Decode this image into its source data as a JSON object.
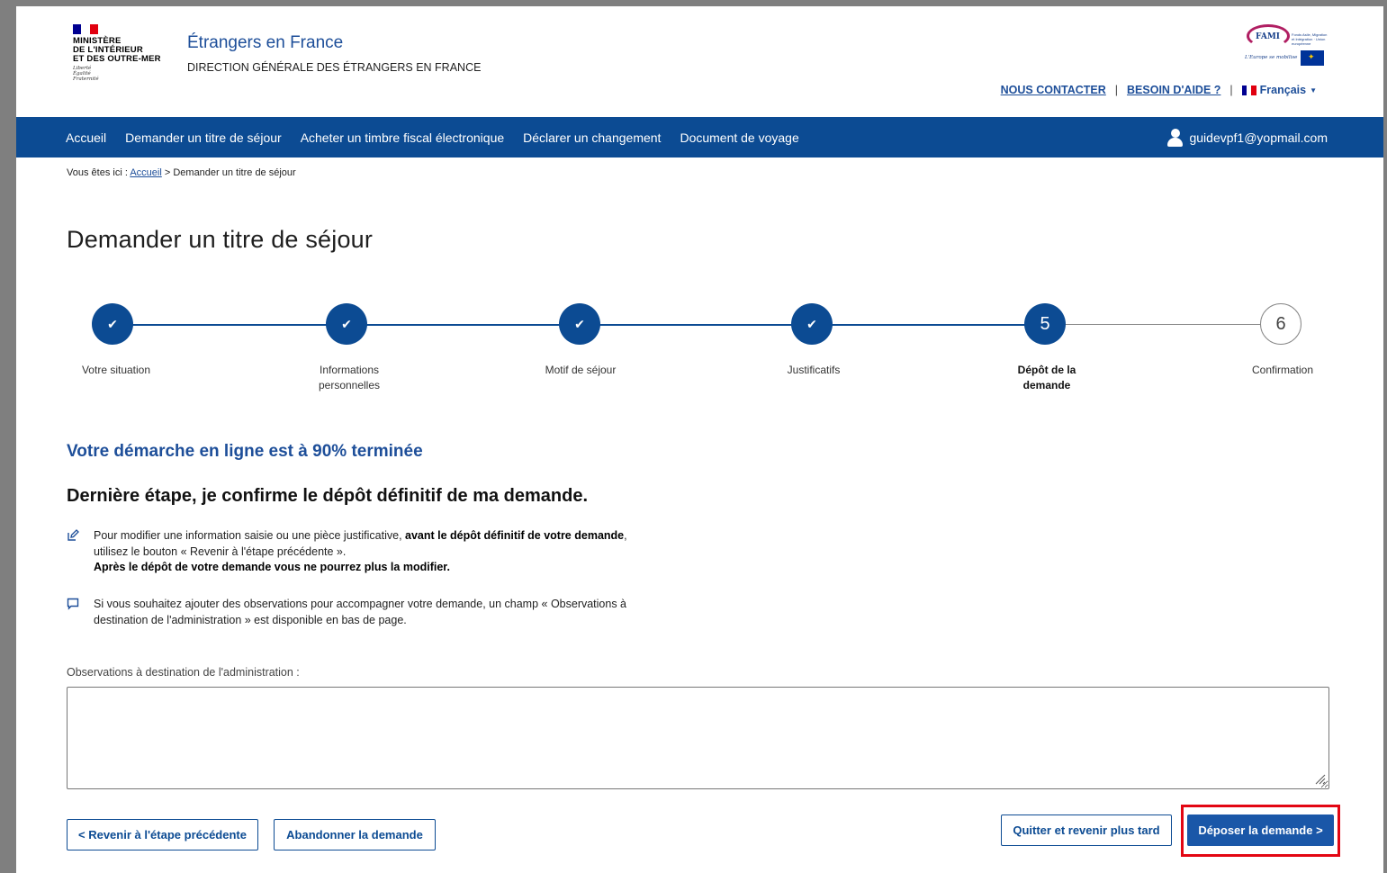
{
  "header": {
    "ministry_lines": [
      "MINISTÈRE",
      "DE L'INTÉRIEUR",
      "ET DES OUTRE-MER"
    ],
    "devise_lines": [
      "Liberté",
      "Égalité",
      "Fraternité"
    ],
    "site_title": "Étrangers en France",
    "site_subtitle": "DIRECTION GÉNÉRALE DES ÉTRANGERS EN FRANCE",
    "fami": {
      "word": "FAMI",
      "small_text": "Fonds Asile, Migration et Intégration · Union européenne",
      "motto": "L'Europe se mobilise"
    },
    "links": {
      "contact": "NOUS CONTACTER",
      "help": "BESOIN D'AIDE ?",
      "separator": "|",
      "language": "Français"
    }
  },
  "nav": {
    "items": [
      "Accueil",
      "Demander un titre de séjour",
      "Acheter un timbre fiscal électronique",
      "Déclarer un changement",
      "Document de voyage"
    ],
    "user_email": "guidevpf1@yopmail.com"
  },
  "breadcrumb": {
    "prefix": "Vous êtes ici :",
    "home": "Accueil",
    "current": "> Demander un titre de séjour"
  },
  "page_title": "Demander un titre de séjour",
  "stepper": {
    "steps": [
      {
        "label_lines": [
          "Votre situation"
        ],
        "marker": "✔",
        "status": "done"
      },
      {
        "label_lines": [
          "Informations",
          "personnelles"
        ],
        "marker": "✔",
        "status": "done"
      },
      {
        "label_lines": [
          "Motif de séjour"
        ],
        "marker": "✔",
        "status": "done"
      },
      {
        "label_lines": [
          "Justificatifs"
        ],
        "marker": "✔",
        "status": "done"
      },
      {
        "label_lines": [
          "Dépôt de la",
          "demande"
        ],
        "marker": "5",
        "status": "active"
      },
      {
        "label_lines": [
          "Confirmation"
        ],
        "marker": "6",
        "status": "todo"
      }
    ]
  },
  "progress_title": "Votre démarche en ligne est à 90% terminée",
  "last_step_title": "Dernière étape, je confirme le dépôt définitif de ma demande.",
  "info1": {
    "icon": "edit-icon",
    "text_start": "Pour modifier une information saisie ou une pièce justificative, ",
    "bold1": "avant le dépôt définitif de votre demande",
    "text_mid": ",",
    "line2": "utilisez le bouton « Revenir à l'étape précédente ».",
    "bold2": "Après le dépôt de votre demande vous ne pourrez plus la modifier."
  },
  "info2": {
    "icon": "comment-icon",
    "line1": "Si vous souhaitez ajouter des observations pour accompagner votre demande, un champ « Observations à",
    "line2": "destination de l'administration » est disponible en bas de page."
  },
  "observations": {
    "label": "Observations à destination de l'administration :",
    "value": ""
  },
  "buttons": {
    "back": "< Revenir à l'étape précédente",
    "abandon": "Abandonner la demande",
    "quit": "Quitter et revenir plus tard",
    "submit": "Déposer la demande >"
  },
  "colors": {
    "brand_blue": "#0c4b93",
    "link_blue": "#1d4e99",
    "primary_button": "#1a57a8",
    "highlight_red": "#e30613"
  }
}
